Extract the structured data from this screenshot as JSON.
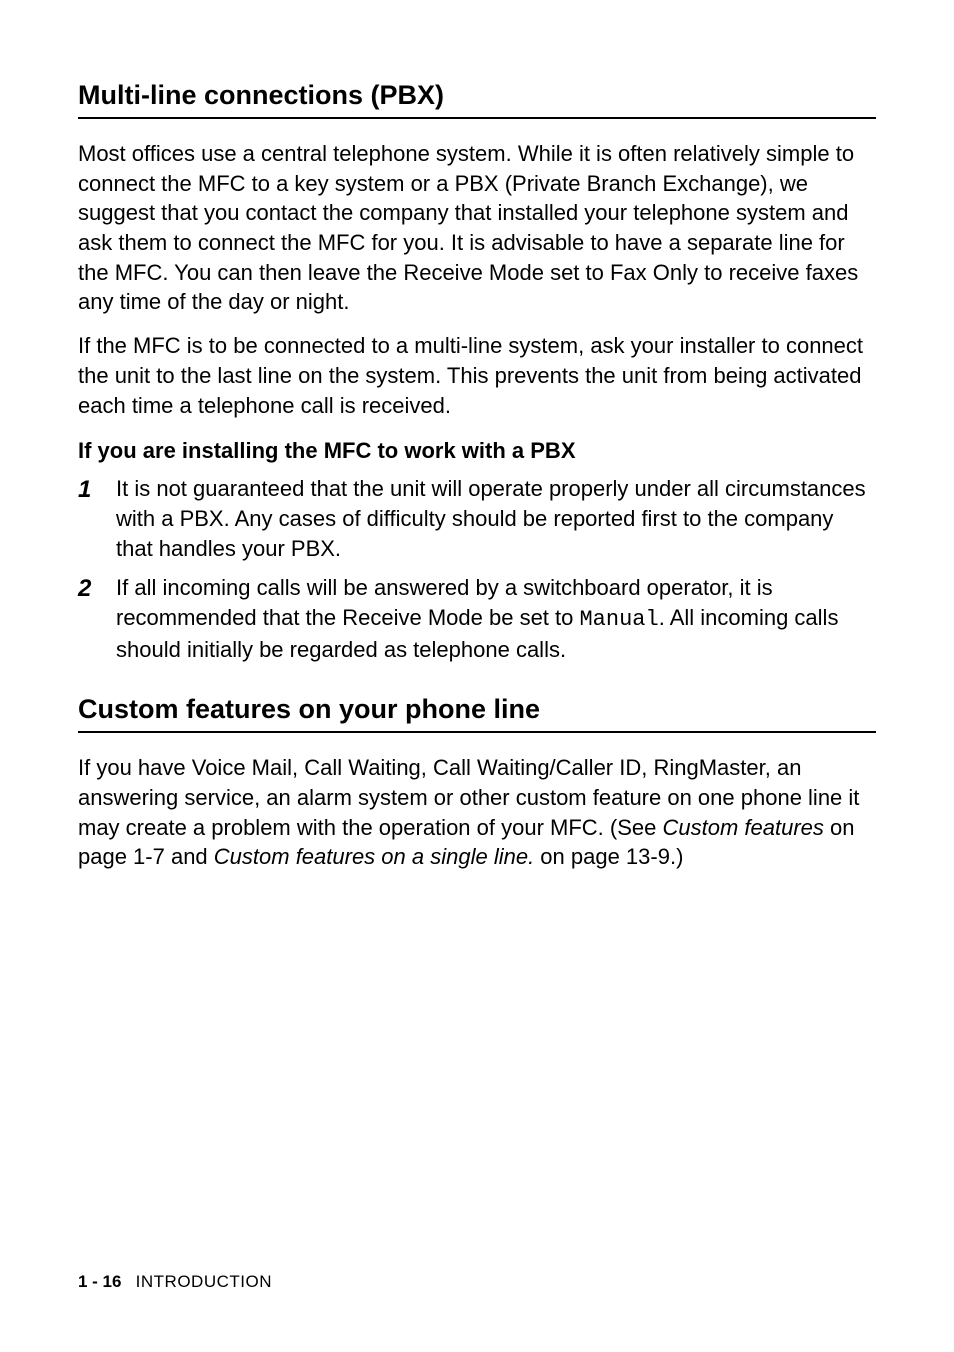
{
  "section1": {
    "heading": "Multi-line connections (PBX)",
    "para1": "Most offices use a central telephone system. While it is often relatively simple to connect the MFC to a key system or a PBX (Private Branch Exchange), we suggest that you contact the company that installed your telephone system and ask them to connect the MFC for you. It is advisable to have a separate line for the MFC. You can then leave the Receive Mode set to Fax Only to receive faxes any time of the day or night.",
    "para2": "If the MFC is to be connected to a multi-line system, ask your installer to connect the unit to the last line on the system. This prevents the unit from being activated each time a telephone call is received.",
    "subheading": "If you are installing the MFC to work with a PBX",
    "items": [
      {
        "num": "1",
        "text": "It is not guaranteed that the unit will operate properly under all circumstances with a PBX. Any cases of difficulty should be reported first to the company that handles your PBX."
      },
      {
        "num": "2",
        "pre": "If all incoming calls will be answered by a switchboard operator, it is recommended that the Receive Mode be set to ",
        "mono": "Manual",
        "post": ". All incoming calls should initially be regarded as telephone calls."
      }
    ]
  },
  "section2": {
    "heading": "Custom features on your phone line",
    "para_pre": "If you have Voice Mail, Call Waiting, Call Waiting/Caller ID, RingMaster, an answering service, an alarm system or other custom feature on one phone line it may create a problem with the operation of your MFC. (See ",
    "ref1": "Custom features",
    "mid1": " on page 1-7 and ",
    "ref2": "Custom features on a single line.",
    "mid2": " on page 13-9.)"
  },
  "footer": {
    "page": "1 - 16",
    "label": "INTRODUCTION"
  }
}
